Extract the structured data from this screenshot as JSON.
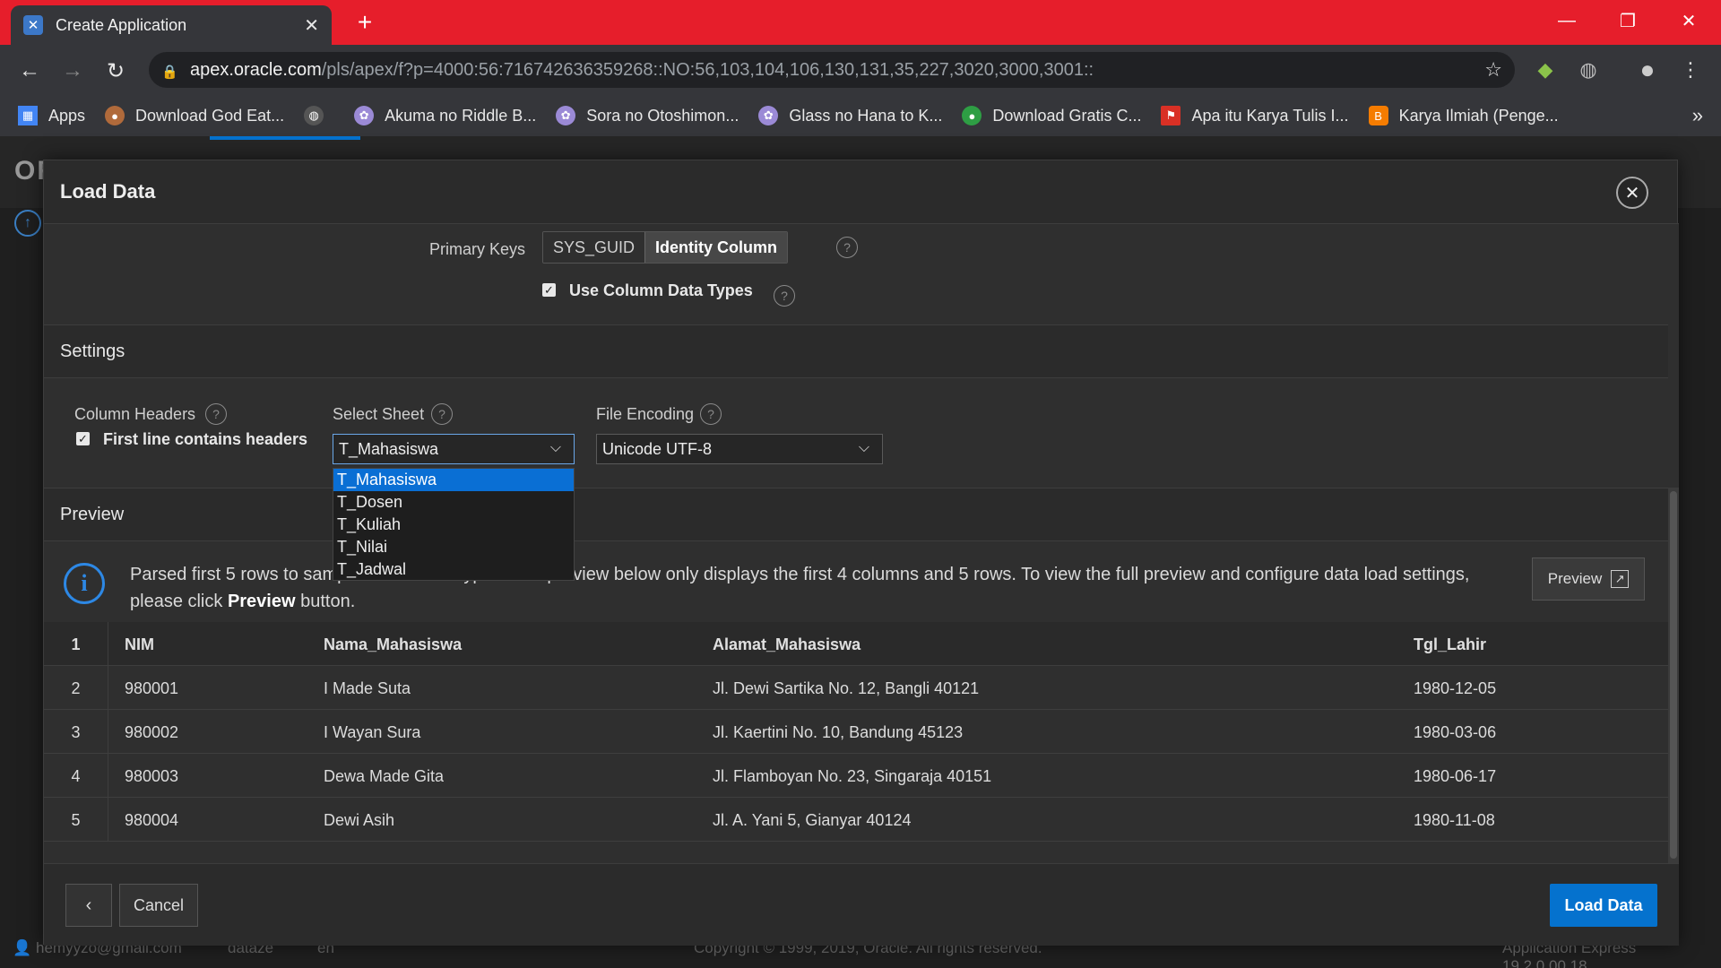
{
  "browser": {
    "tab_title": "Create Application",
    "tab_close": "✕",
    "new_tab": "+",
    "url_host": "apex.oracle.com",
    "url_path": "/pls/apex/f?p=4000:56:716742636359268::NO:56,103,104,106,130,131,35,227,3020,3000,3001::",
    "bookmarks": [
      {
        "label": "Apps",
        "icon": "apps-grid-icon",
        "color": "#4285f4"
      },
      {
        "label": "Download God Eat...",
        "icon": "avatar-icon",
        "color": "#b06a3b"
      },
      {
        "label": "",
        "icon": "globe-icon",
        "color": "#555555"
      },
      {
        "label": "Akuma no Riddle B...",
        "icon": "anime-icon",
        "color": "#9b8ad6"
      },
      {
        "label": "Sora no Otoshimon...",
        "icon": "anime-icon",
        "color": "#9b8ad6"
      },
      {
        "label": "Glass no Hana to K...",
        "icon": "anime-icon",
        "color": "#9b8ad6"
      },
      {
        "label": "Download Gratis C...",
        "icon": "leaf-icon",
        "color": "#2e9e44"
      },
      {
        "label": "Apa itu Karya Tulis I...",
        "icon": "flag-icon",
        "color": "#d93025"
      },
      {
        "label": "Karya Ilmiah (Penge...",
        "icon": "blogger-icon",
        "color": "#f57c00"
      }
    ],
    "more_bookmarks": "»"
  },
  "apex": {
    "logo": "ORACLE",
    "footer_user": "hemyyzo@gmail.com",
    "footer_ws": "dataze",
    "footer_lang": "en",
    "footer_copyright": "Copyright © 1999, 2019, Oracle. All rights reserved.",
    "footer_version": "Application Express 19.2.0.00.18"
  },
  "modal": {
    "title": "Load Data",
    "close": "✕",
    "primary_keys_label": "Primary Keys",
    "pk_options": [
      "SYS_GUID",
      "Identity Column"
    ],
    "pk_selected": "Identity Column",
    "use_column_types_label": "Use Column Data Types",
    "use_column_types_checked": true,
    "settings_title": "Settings",
    "column_headers_label": "Column Headers",
    "first_line_headers_label": "First line contains headers",
    "first_line_headers_checked": true,
    "select_sheet_label": "Select Sheet",
    "select_sheet_value": "T_Mahasiswa",
    "sheet_options": [
      "T_Mahasiswa",
      "T_Dosen",
      "T_Kuliah",
      "T_Nilai",
      "T_Jadwal"
    ],
    "file_encoding_label": "File Encoding",
    "file_encoding_value": "Unicode UTF-8",
    "preview_title": "Preview",
    "info_text_1": "Parsed first 5 rows to sample the column types. The preview below only displays the first 4 columns and 5 rows. To view the full preview and configure data load settings, please click ",
    "info_text_bold": "Preview",
    "info_text_2": " button.",
    "preview_button": "Preview",
    "grid": {
      "header_num": "1",
      "columns": [
        "NIM",
        "Nama_Mahasiswa",
        "Alamat_Mahasiswa",
        "Tgl_Lahir"
      ],
      "rows": [
        {
          "num": "2",
          "cells": [
            "980001",
            "I Made Suta",
            "Jl. Dewi Sartika No. 12, Bangli 40121",
            "1980-12-05"
          ]
        },
        {
          "num": "3",
          "cells": [
            "980002",
            "I Wayan Sura",
            "Jl. Kaertini No. 10, Bandung 45123",
            "1980-03-06"
          ]
        },
        {
          "num": "4",
          "cells": [
            "980003",
            "Dewa Made Gita",
            "Jl. Flamboyan No. 23, Singaraja 40151",
            "1980-06-17"
          ]
        },
        {
          "num": "5",
          "cells": [
            "980004",
            "Dewi Asih",
            "Jl. A. Yani 5, Gianyar 40124",
            "1980-11-08"
          ]
        }
      ]
    },
    "back_button": "‹",
    "cancel_button": "Cancel",
    "load_button": "Load Data"
  },
  "colors": {
    "chrome_tabbar": "#e61e2b",
    "accent": "#0572ce",
    "selection": "#0a6fd4"
  }
}
